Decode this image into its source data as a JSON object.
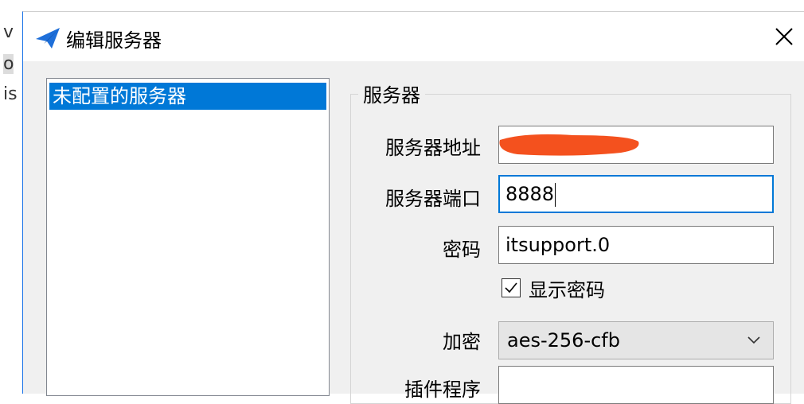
{
  "dialog": {
    "title": "编辑服务器",
    "close_icon": "close-icon",
    "app_icon": "paper-plane-icon"
  },
  "server_list": {
    "items": [
      {
        "label": "未配置的服务器",
        "selected": true
      }
    ]
  },
  "server_group": {
    "title": "服务器",
    "address_label": "服务器地址",
    "address_value": "",
    "port_label": "服务器端口",
    "port_value": "8888",
    "password_label": "密码",
    "password_value": "itsupport.0",
    "show_password_label": "显示密码",
    "show_password_checked": true,
    "encryption_label": "加密",
    "encryption_value": "aes-256-cfb",
    "plugin_label": "插件程序",
    "plugin_value": ""
  },
  "colors": {
    "selection": "#0078d7",
    "redaction": "#f4511e",
    "dialog_bg": "#f0f0f0"
  }
}
